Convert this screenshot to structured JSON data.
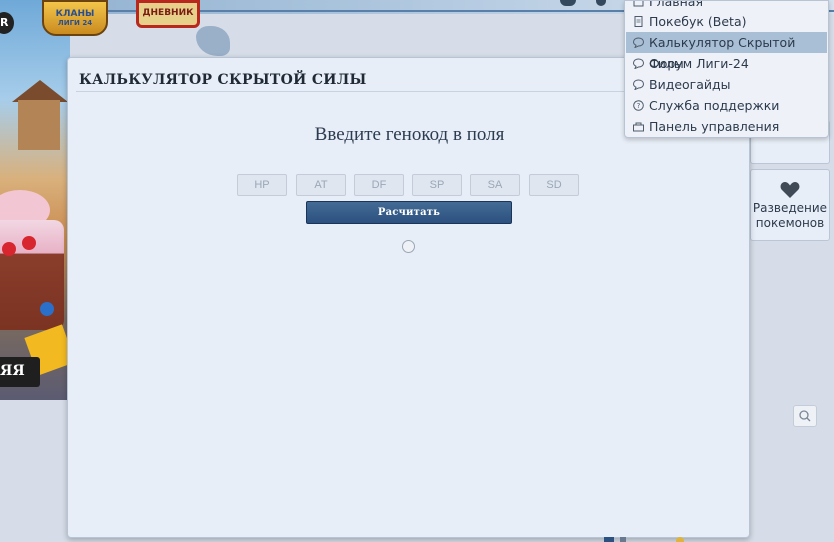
{
  "header": {
    "rank_label": "R",
    "clans_line1": "КЛАНЫ",
    "clans_line2": "ЛИГИ 24",
    "diary_label": "ДНЕВНИК",
    "banner_text": "ЯЯ"
  },
  "modal": {
    "title": "КАЛЬКУЛЯТОР СКРЫТОЙ СИЛЫ",
    "prompt": "Введите генокод в поля",
    "fields": [
      {
        "placeholder": "HP"
      },
      {
        "placeholder": "AT"
      },
      {
        "placeholder": "DF"
      },
      {
        "placeholder": "SP"
      },
      {
        "placeholder": "SA"
      },
      {
        "placeholder": "SD"
      }
    ],
    "calculate_label": "Расчитать"
  },
  "sidebar": {
    "breeding_label": "Разведение покемонов"
  },
  "menu": {
    "items": [
      {
        "label": "Главная",
        "icon": "home-icon"
      },
      {
        "label": "Покебук (Beta)",
        "icon": "document-icon"
      },
      {
        "label": "Калькулятор Скрытой Силы",
        "icon": "chat-bubble-icon",
        "active": true
      },
      {
        "label": "Форум Лиги-24",
        "icon": "chat-bubble-icon"
      },
      {
        "label": "Видеогайды",
        "icon": "chat-bubble-icon"
      },
      {
        "label": "Служба поддержки",
        "icon": "question-icon"
      },
      {
        "label": "Панель управления",
        "icon": "dashboard-icon"
      }
    ]
  },
  "colors": {
    "accent": "#2c5080",
    "menu_active": "#a9bfd6",
    "modal_bg": "#e8eef7"
  }
}
